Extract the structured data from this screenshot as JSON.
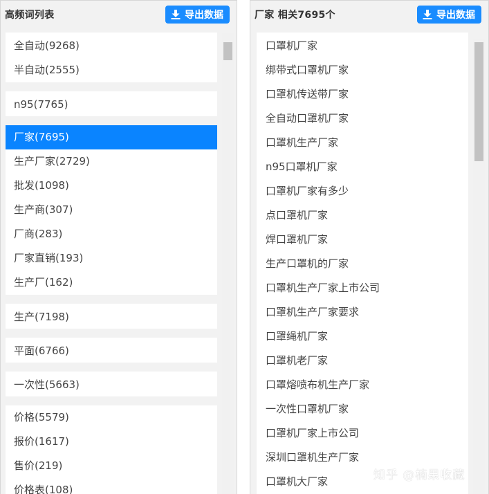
{
  "left_panel": {
    "title": "高频词列表",
    "export_label": "导出数据",
    "groups": [
      {
        "items": [
          "全自动(9268)",
          "半自动(2555)"
        ]
      },
      {
        "items": [
          "n95(7765)"
        ]
      },
      {
        "items": [
          "厂家(7695)",
          "生产厂家(2729)",
          "批发(1098)",
          "生产商(307)",
          "厂商(283)",
          "厂家直销(193)",
          "生产厂(162)"
        ],
        "selected": "厂家(7695)"
      },
      {
        "items": [
          "生产(7198)"
        ]
      },
      {
        "items": [
          "平面(6766)"
        ]
      },
      {
        "items": [
          "一次性(5663)"
        ]
      },
      {
        "items": [
          "价格(5579)",
          "报价(1617)",
          "售价(219)",
          "价格表(108)"
        ]
      }
    ]
  },
  "right_panel": {
    "title": "厂家 相关7695个",
    "export_label": "导出数据",
    "items": [
      "口罩机厂家",
      "绑带式口罩机厂家",
      "口罩机传送带厂家",
      "全自动口罩机厂家",
      "口罩机生产厂家",
      "n95口罩机厂家",
      "口罩机厂家有多少",
      "点口罩机厂家",
      "焊口罩机厂家",
      "生产口罩机的厂家",
      "口罩机生产厂家上市公司",
      "口罩机生产厂家要求",
      "口罩绳机厂家",
      "口罩机老厂家",
      "口罩熔喷布机生产厂家",
      "一次性口罩机厂家",
      "口罩机厂家上市公司",
      "深圳口罩机生产厂家",
      "口罩机大厂家"
    ]
  },
  "watermark": "知乎 @楠果收藏",
  "colors": {
    "accent": "#1a8cff",
    "selected": "#0a84ff",
    "panel_bg": "#f2f2f2"
  }
}
